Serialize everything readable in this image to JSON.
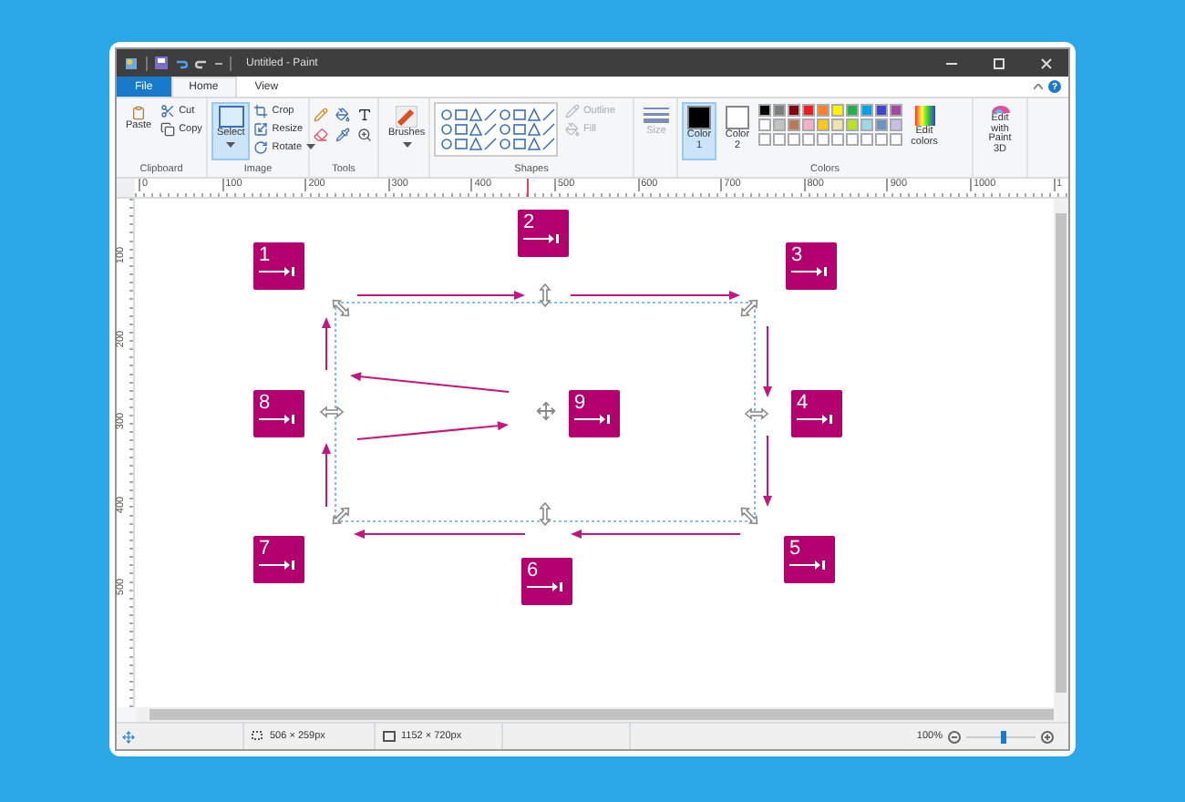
{
  "window": {
    "title": "Untitled - Paint"
  },
  "tabs": [
    {
      "label": "File",
      "kind": "file",
      "selected": false
    },
    {
      "label": "Home",
      "kind": "tab",
      "selected": true
    },
    {
      "label": "View",
      "kind": "tab",
      "selected": false
    }
  ],
  "help": "?",
  "ribbon": {
    "clipboard": {
      "label": "Clipboard",
      "paste": "Paste",
      "cut": "Cut",
      "copy": "Copy"
    },
    "image": {
      "label": "Image",
      "select": {
        "label": "Select",
        "selected": true
      },
      "crop": "Crop",
      "resize": "Resize",
      "rotate": "Rotate"
    },
    "tools": {
      "label": "Tools"
    },
    "brushes": {
      "label": "Brushes"
    },
    "shapes": {
      "label": "Shapes",
      "outline": {
        "label": "Outline",
        "disabled": true
      },
      "fill": {
        "label": "Fill",
        "disabled": true
      }
    },
    "size": {
      "label": "Size",
      "disabled": true
    },
    "colors": {
      "label": "Colors",
      "color1": {
        "label": "Color 1",
        "selected": true,
        "color": "#000000"
      },
      "color2": {
        "label": "Color 2",
        "selected": false,
        "color": "#ffffff"
      },
      "palette": [
        {
          "color": "#000000"
        },
        {
          "color": "#7f7f7f"
        },
        {
          "color": "#880015"
        },
        {
          "color": "#ed1c24"
        },
        {
          "color": "#ff7f27"
        },
        {
          "color": "#fff200"
        },
        {
          "color": "#22b14c"
        },
        {
          "color": "#00a2e8"
        },
        {
          "color": "#3f48cc"
        },
        {
          "color": "#a349a4"
        },
        {
          "color": "#ffffff"
        },
        {
          "color": "#c3c3c3"
        },
        {
          "color": "#b97a57"
        },
        {
          "color": "#ffaec9"
        },
        {
          "color": "#ffc90e"
        },
        {
          "color": "#efe4b0"
        },
        {
          "color": "#b5e61d"
        },
        {
          "color": "#99d9ea"
        },
        {
          "color": "#7092be"
        },
        {
          "color": "#c8bfe7"
        }
      ],
      "edit": "Edit colors"
    },
    "paint3d": "Edit with Paint 3D"
  },
  "ruler_h": [
    "0",
    "100",
    "200",
    "300",
    "400",
    "500",
    "600",
    "700",
    "800",
    "900",
    "1000",
    "1"
  ],
  "ruler_v": [
    "100",
    "200",
    "300",
    "400",
    "500"
  ],
  "canvas": {
    "steps": [
      {
        "label": "2"
      },
      {
        "label": "1"
      },
      {
        "label": "3"
      },
      {
        "label": "8"
      },
      {
        "label": "9"
      },
      {
        "label": "4"
      },
      {
        "label": "7"
      },
      {
        "label": "5"
      },
      {
        "label": "6"
      }
    ]
  },
  "status": {
    "selection": "506 × 259px",
    "image": "1152 × 720px",
    "zoom": {
      "reading": "100%",
      "level": 0.55
    }
  }
}
